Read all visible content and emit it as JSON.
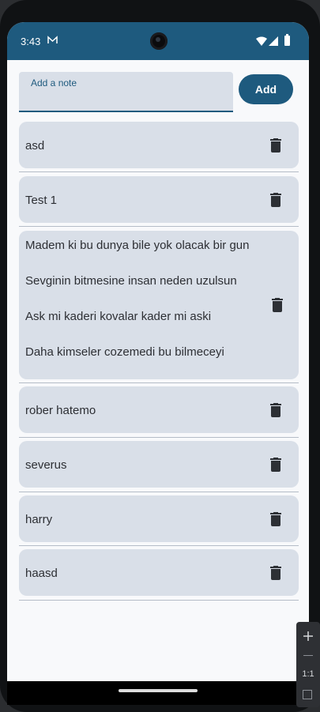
{
  "status_bar": {
    "time": "3:43"
  },
  "note_input": {
    "label": "Add a note",
    "value": ""
  },
  "add_button": {
    "label": "Add"
  },
  "notes": [
    {
      "text": "asd"
    },
    {
      "text": "Test 1"
    },
    {
      "lines": [
        "Madem ki bu dunya bile yok olacak bir gun",
        "Sevginin bitmesine insan neden uzulsun",
        "Ask mi kaderi kovalar kader mi aski",
        "Daha kimseler cozemedi bu bilmeceyi"
      ]
    },
    {
      "text": "rober hatemo"
    },
    {
      "text": "severus"
    },
    {
      "text": "harry"
    },
    {
      "text": "haasd"
    }
  ],
  "emulator_toolbar": {
    "ratio_label": "1:1"
  },
  "colors": {
    "accent": "#1e5a7e",
    "card": "#d9dfe8",
    "background": "#f8f9fb"
  }
}
